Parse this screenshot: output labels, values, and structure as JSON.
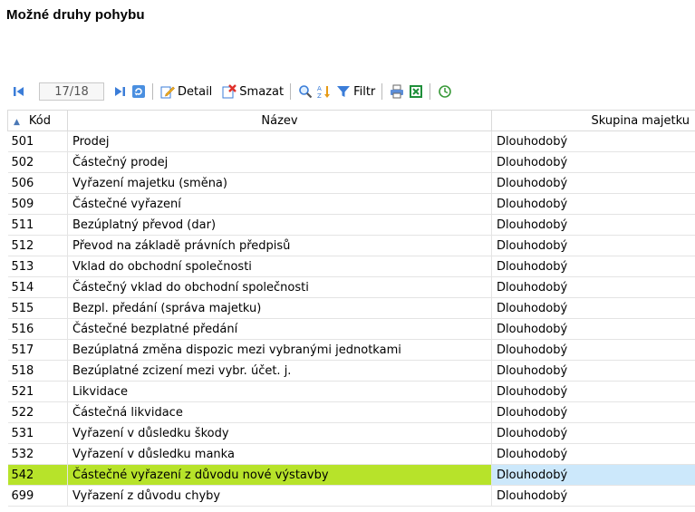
{
  "page": {
    "title": "Možné druhy pohybu"
  },
  "toolbar": {
    "page_indicator": "17/18",
    "detail_label": "Detail",
    "delete_label": "Smazat",
    "filter_label": "Filtr"
  },
  "colors": {
    "selected_row": "#b7e32a",
    "selected_cell": "#cce8fb",
    "accent": "#2d6bc4"
  },
  "table": {
    "columns": [
      "Kód",
      "Název",
      "Skupina majetku"
    ],
    "sort_column": "Kód",
    "selected_code": "542",
    "rows": [
      {
        "code": "501",
        "name": "Prodej",
        "group": "Dlouhodobý"
      },
      {
        "code": "502",
        "name": "Částečný prodej",
        "group": "Dlouhodobý"
      },
      {
        "code": "506",
        "name": "Vyřazení majetku (směna)",
        "group": "Dlouhodobý"
      },
      {
        "code": "509",
        "name": "Částečné vyřazení",
        "group": "Dlouhodobý"
      },
      {
        "code": "511",
        "name": "Bezúplatný převod (dar)",
        "group": "Dlouhodobý"
      },
      {
        "code": "512",
        "name": "Převod na základě právních předpisů",
        "group": "Dlouhodobý"
      },
      {
        "code": "513",
        "name": "Vklad do obchodní společnosti",
        "group": "Dlouhodobý"
      },
      {
        "code": "514",
        "name": "Částečný vklad do obchodní společnosti",
        "group": "Dlouhodobý"
      },
      {
        "code": "515",
        "name": "Bezpl. předání (správa majetku)",
        "group": "Dlouhodobý"
      },
      {
        "code": "516",
        "name": "Částečné bezplatné předání",
        "group": "Dlouhodobý"
      },
      {
        "code": "517",
        "name": "Bezúplatná změna dispozic mezi vybranými jednotkami",
        "group": "Dlouhodobý"
      },
      {
        "code": "518",
        "name": "Bezúplatné zcizení mezi vybr. účet. j.",
        "group": "Dlouhodobý"
      },
      {
        "code": "521",
        "name": "Likvidace",
        "group": "Dlouhodobý"
      },
      {
        "code": "522",
        "name": "Částečná likvidace",
        "group": "Dlouhodobý"
      },
      {
        "code": "531",
        "name": "Vyřazení v důsledku škody",
        "group": "Dlouhodobý"
      },
      {
        "code": "532",
        "name": "Vyřazení v důsledku manka",
        "group": "Dlouhodobý"
      },
      {
        "code": "542",
        "name": "Částečné vyřazení z důvodu nové výstavby",
        "group": "Dlouhodobý"
      },
      {
        "code": "699",
        "name": "Vyřazení z důvodu chyby",
        "group": "Dlouhodobý"
      }
    ]
  }
}
